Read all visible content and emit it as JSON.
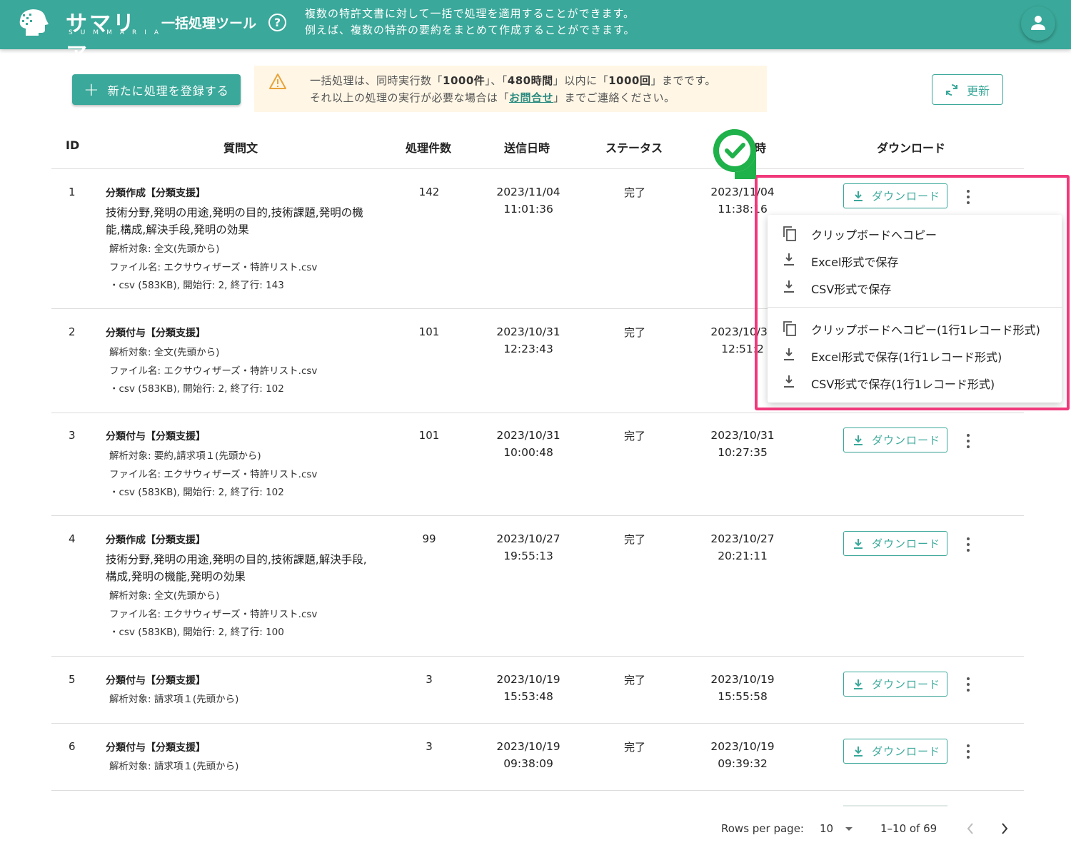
{
  "header": {
    "logo_text": "サマリア",
    "logo_sub": "SUMMARIA",
    "tool_title": "一括処理ツール",
    "help_icon": "?",
    "desc_line1": "複数の特許文書に対して一括で処理を適用することができます。",
    "desc_line2": "例えば、複数の特許の要約をまとめて作成することができます。",
    "avatar_icon": "person-icon"
  },
  "toolbar": {
    "new_button": "新たに処理を登録する",
    "notice": {
      "l1_a": "一括処理は、同時実行数「",
      "l1_b": "1000件",
      "l1_c": "」、「",
      "l1_d": "480時間",
      "l1_e": "」以内に「",
      "l1_f": "1000回",
      "l1_g": "」までです。",
      "l2_a": "それ以上の処理の実行が必要な場合は「",
      "l2_link": "お問合せ",
      "l2_b": "」までご連絡ください。"
    },
    "refresh_button": "更新"
  },
  "table": {
    "headers": {
      "id": "ID",
      "question": "質問文",
      "count": "処理件数",
      "sent": "送信日時",
      "status": "ステータス",
      "done_visible": "時",
      "download": "ダウンロード"
    },
    "download_label": "ダウンロード",
    "rows": [
      {
        "id": "1",
        "title": "分類作成【分類支援】",
        "body": "技術分野,発明の用途,発明の目的,技術課題,発明の機能,構成,解決手段,発明の効果",
        "meta1": "解析対象: 全文(先頭から)",
        "meta2": "ファイル名: エクサウィザーズ・特許リスト.csv",
        "meta3": "・csv (583KB), 開始行: 2, 終了行: 143",
        "count": "142",
        "sent_date": "2023/11/04",
        "sent_time": "11:01:36",
        "status": "完了",
        "done_date": "2023/11/04",
        "done_time": "11:38:16"
      },
      {
        "id": "2",
        "title": "分類付与【分類支援】",
        "body": "",
        "meta1": "解析対象: 全文(先頭から)",
        "meta2": "ファイル名: エクサウィザーズ・特許リスト.csv",
        "meta3": "・csv (583KB), 開始行: 2, 終了行: 102",
        "count": "101",
        "sent_date": "2023/10/31",
        "sent_time": "12:23:43",
        "status": "完了",
        "done_date": "2023/10/31",
        "done_time": "12:51:2"
      },
      {
        "id": "3",
        "title": "分類付与【分類支援】",
        "body": "",
        "meta1": "解析対象: 要約,請求項１(先頭から)",
        "meta2": "ファイル名: エクサウィザーズ・特許リスト.csv",
        "meta3": "・csv (583KB), 開始行: 2, 終了行: 102",
        "count": "101",
        "sent_date": "2023/10/31",
        "sent_time": "10:00:48",
        "status": "完了",
        "done_date": "2023/10/31",
        "done_time": "10:27:35"
      },
      {
        "id": "4",
        "title": "分類作成【分類支援】",
        "body": "技術分野,発明の用途,発明の目的,技術課題,解決手段,構成,発明の機能,発明の効果",
        "meta1": "解析対象: 全文(先頭から)",
        "meta2": "ファイル名: エクサウィザーズ・特許リスト.csv",
        "meta3": "・csv (583KB), 開始行: 2, 終了行: 100",
        "count": "99",
        "sent_date": "2023/10/27",
        "sent_time": "19:55:13",
        "status": "完了",
        "done_date": "2023/10/27",
        "done_time": "20:21:11"
      },
      {
        "id": "5",
        "title": "分類付与【分類支援】",
        "body": "",
        "meta1": "解析対象: 請求項１(先頭から)",
        "meta2": "",
        "meta3": "",
        "count": "3",
        "sent_date": "2023/10/19",
        "sent_time": "15:53:48",
        "status": "完了",
        "done_date": "2023/10/19",
        "done_time": "15:55:58"
      },
      {
        "id": "6",
        "title": "分類付与【分類支援】",
        "body": "",
        "meta1": "解析対象: 請求項１(先頭から)",
        "meta2": "",
        "meta3": "",
        "count": "3",
        "sent_date": "2023/10/19",
        "sent_time": "09:38:09",
        "status": "完了",
        "done_date": "2023/10/19",
        "done_time": "09:39:32"
      }
    ]
  },
  "menu": {
    "items": [
      {
        "icon": "copy-icon",
        "label": "クリップボードへコピー"
      },
      {
        "icon": "download-icon",
        "label": "Excel形式で保存"
      },
      {
        "icon": "download-icon",
        "label": "CSV形式で保存"
      },
      {
        "icon": "copy-icon",
        "label": "クリップボードへコピー(1行1レコード形式)"
      },
      {
        "icon": "download-icon",
        "label": "Excel形式で保存(1行1レコード形式)"
      },
      {
        "icon": "download-icon",
        "label": "CSV形式で保存(1行1レコード形式)"
      }
    ]
  },
  "pagination": {
    "rows_per_page_label": "Rows per page:",
    "rows_per_page_value": "10",
    "range": "1–10 of 69"
  },
  "colors": {
    "brand": "#3aa89a",
    "highlight": "#f0387a",
    "check": "#1fb14a",
    "notice_bg": "#fff6e5"
  }
}
